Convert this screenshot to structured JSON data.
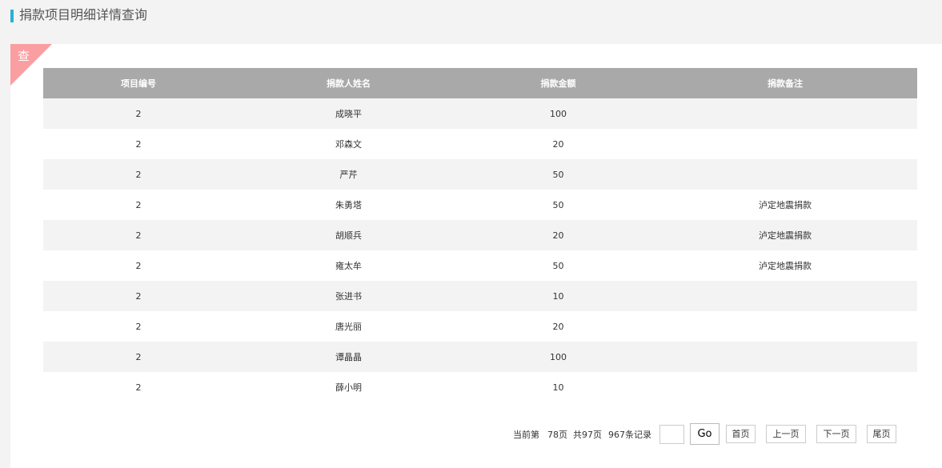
{
  "header": {
    "title": "捐款项目明细详情查询"
  },
  "corner_label": "查",
  "table": {
    "columns": [
      "项目编号",
      "捐款人姓名",
      "捐款金额",
      "捐款备注"
    ],
    "rows": [
      [
        "2",
        "成晓平",
        "100",
        ""
      ],
      [
        "2",
        "邓森文",
        "20",
        ""
      ],
      [
        "2",
        "严芹",
        "50",
        ""
      ],
      [
        "2",
        "朱勇塔",
        "50",
        "泸定地震捐款"
      ],
      [
        "2",
        "胡顺兵",
        "20",
        "泸定地震捐款"
      ],
      [
        "2",
        "雍太牟",
        "50",
        "泸定地震捐款"
      ],
      [
        "2",
        "张进书",
        "10",
        ""
      ],
      [
        "2",
        "唐光丽",
        "20",
        ""
      ],
      [
        "2",
        "谭晶晶",
        "100",
        ""
      ],
      [
        "2",
        "薛小明",
        "10",
        ""
      ]
    ]
  },
  "pager": {
    "current_label": "当前第",
    "current_page": "78页",
    "total_pages": "共97页",
    "total_records": "967条记录",
    "jump_value": "",
    "go_label": "Go",
    "first_label": "首页",
    "prev_label": "上一页",
    "next_label": "下一页",
    "last_label": "尾页"
  },
  "colors": {
    "accent": "#26b3d3",
    "corner": "#fa9ea2",
    "table_header": "#a9a9a9",
    "stripe": "#f3f3f3"
  }
}
